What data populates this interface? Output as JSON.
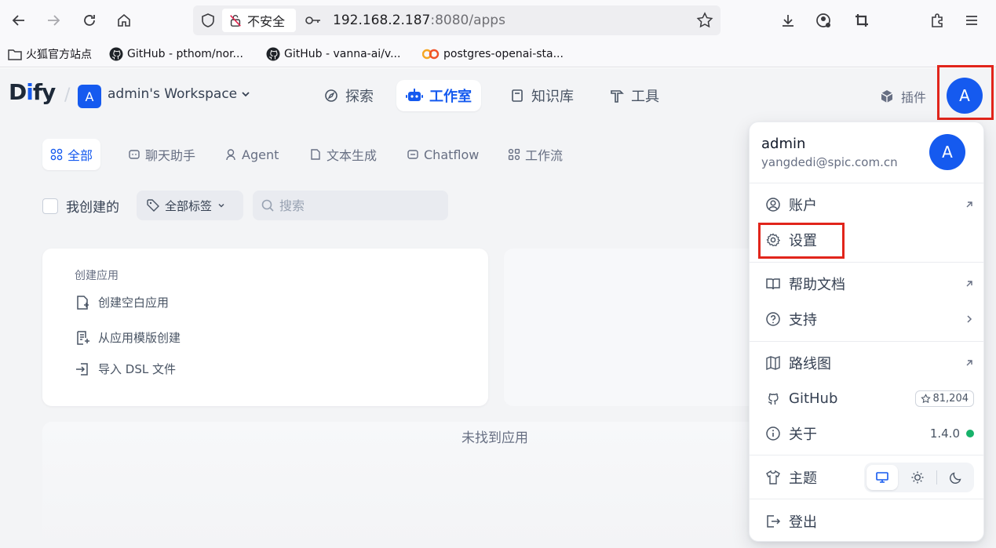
{
  "browser": {
    "security_label": "不安全",
    "url_host": "192.168.2.187",
    "url_path": ":8080/apps",
    "bookmarks": [
      {
        "label": "火狐官方站点",
        "icon": "folder-icon"
      },
      {
        "label": "GitHub - pthom/nor...",
        "icon": "github-icon"
      },
      {
        "label": "GitHub - vanna-ai/v...",
        "icon": "github-icon"
      },
      {
        "label": "postgres-openai-sta...",
        "icon": "co-logo-icon"
      }
    ]
  },
  "header": {
    "logo": {
      "d": "D",
      "i": "i",
      "rest": "fy"
    },
    "workspace_initial": "A",
    "workspace_name": "admin's Workspace",
    "nav": [
      {
        "label": "探索",
        "icon": "compass-icon",
        "active": false
      },
      {
        "label": "工作室",
        "icon": "robot-icon",
        "active": true
      },
      {
        "label": "知识库",
        "icon": "book-icon",
        "active": false
      },
      {
        "label": "工具",
        "icon": "hammer-icon",
        "active": false
      }
    ],
    "plugins_label": "插件",
    "user_initial": "A"
  },
  "filters": {
    "tabs": [
      {
        "label": "全部",
        "active": true
      },
      {
        "label": "聊天助手",
        "active": false
      },
      {
        "label": "Agent",
        "active": false
      },
      {
        "label": "文本生成",
        "active": false
      },
      {
        "label": "Chatflow",
        "active": false
      },
      {
        "label": "工作流",
        "active": false
      }
    ],
    "my_created_label": "我创建的",
    "tag_filter_label": "全部标签",
    "search_placeholder": "搜索"
  },
  "create_card": {
    "title": "创建应用",
    "items": [
      "创建空白应用",
      "从应用模版创建",
      "导入 DSL 文件"
    ]
  },
  "empty_text": "未找到应用",
  "dropdown": {
    "user_name": "admin",
    "user_email": "yangdedi@spic.com.cn",
    "user_initial": "A",
    "items": {
      "account": "账户",
      "settings": "设置",
      "help_docs": "帮助文档",
      "support": "支持",
      "roadmap": "路线图",
      "github": "GitHub",
      "github_stars": "81,204",
      "about": "关于",
      "version": "1.4.0",
      "theme": "主题",
      "logout": "登出"
    }
  },
  "colors": {
    "accent": "#155aef",
    "highlight": "#e1251b",
    "status_ok": "#17b26a"
  }
}
